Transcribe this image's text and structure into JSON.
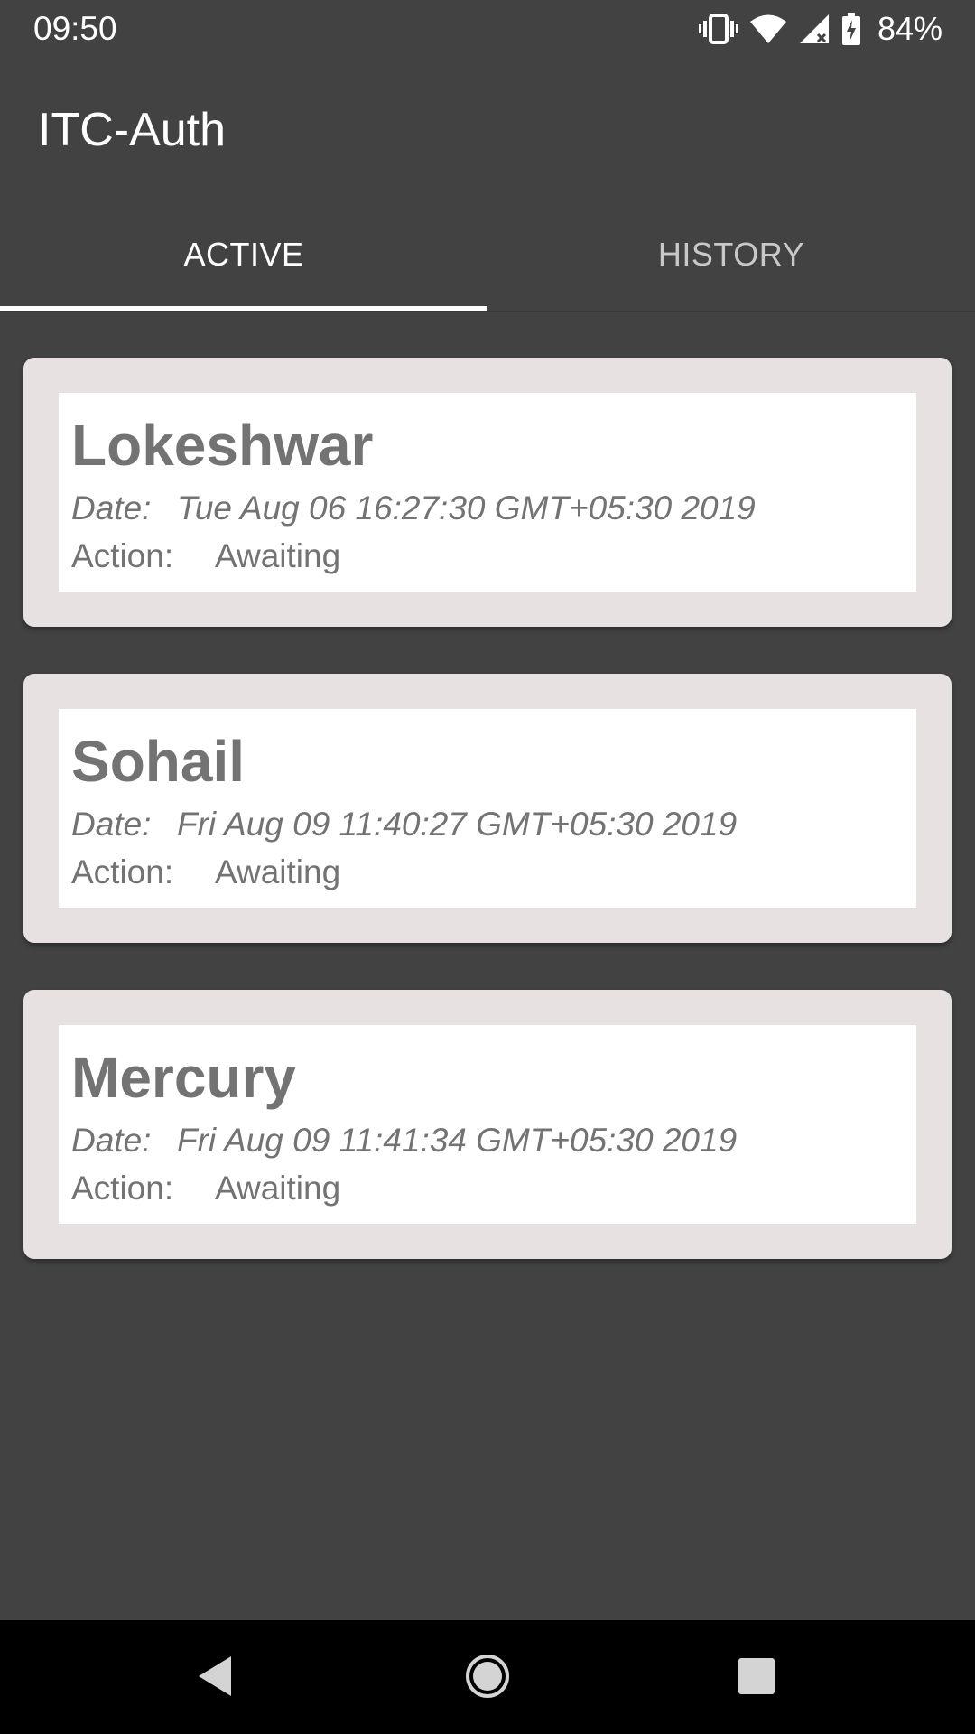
{
  "status_bar": {
    "time": "09:50",
    "battery_percent": "84%",
    "icons": [
      "vibrate-icon",
      "wifi-icon",
      "cell-signal-icon",
      "battery-charging-icon"
    ]
  },
  "app_bar": {
    "title": "ITC-Auth"
  },
  "tabs": [
    {
      "label": "ACTIVE",
      "selected": true
    },
    {
      "label": "HISTORY",
      "selected": false
    }
  ],
  "requests": [
    {
      "name": "Lokeshwar",
      "date_label": "Date:",
      "date": "Tue Aug 06 16:27:30 GMT+05:30 2019",
      "action_label": "Action:",
      "action": "Awaiting"
    },
    {
      "name": "Sohail",
      "date_label": "Date:",
      "date": "Fri Aug 09 11:40:27 GMT+05:30 2019",
      "action_label": "Action:",
      "action": "Awaiting"
    },
    {
      "name": "Mercury",
      "date_label": "Date:",
      "date": "Fri Aug 09 11:41:34 GMT+05:30 2019",
      "action_label": "Action:",
      "action": "Awaiting"
    }
  ],
  "nav_bar": {
    "icons": [
      "back-icon",
      "home-icon",
      "recents-icon"
    ]
  },
  "colors": {
    "background": "#424242",
    "card_outer": "#e8e1e2",
    "card_inner": "#ffffff",
    "card_text": "#737373",
    "tab_indicator": "#ffffff"
  }
}
